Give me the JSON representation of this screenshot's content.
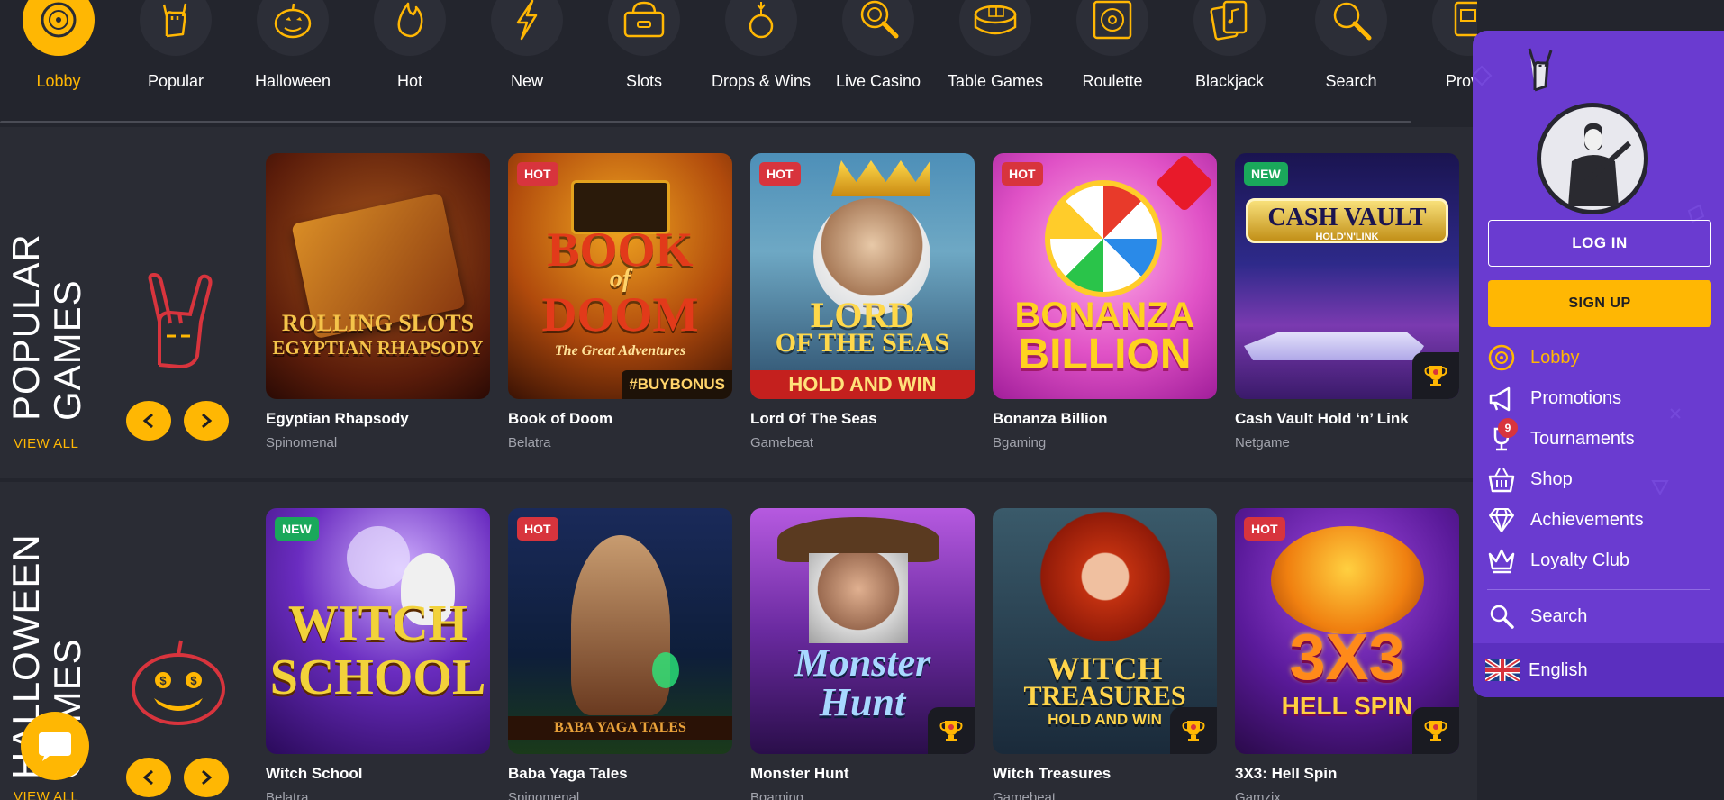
{
  "categories": [
    {
      "label": "Lobby",
      "icon": "disc-icon",
      "active": true
    },
    {
      "label": "Popular",
      "icon": "rock-hand-icon"
    },
    {
      "label": "Halloween",
      "icon": "pumpkin-icon"
    },
    {
      "label": "Hot",
      "icon": "flame-icon"
    },
    {
      "label": "New",
      "icon": "lightning-icon"
    },
    {
      "label": "Slots",
      "icon": "slot-machine-icon"
    },
    {
      "label": "Drops & Wins",
      "icon": "bomb-icon"
    },
    {
      "label": "Live Casino",
      "icon": "roulette-magnifier-icon"
    },
    {
      "label": "Table Games",
      "icon": "poker-table-icon"
    },
    {
      "label": "Roulette",
      "icon": "roulette-icon"
    },
    {
      "label": "Blackjack",
      "icon": "cards-icon"
    },
    {
      "label": "Search",
      "icon": "search-icon"
    },
    {
      "label": "Provic",
      "icon": "provider-icon"
    }
  ],
  "sections": [
    {
      "title_line1": "POPULAR",
      "title_line2": "GAMES",
      "view_all": "VIEW ALL",
      "games": [
        {
          "name": "Egyptian Rhapsody",
          "provider": "Spinomenal",
          "badge": "",
          "art": "ROLLING SLOTS\nEGYPTIAN RHAPSODY",
          "trophy": false
        },
        {
          "name": "Book of Doom",
          "provider": "Belatra",
          "badge": "HOT",
          "art": "BOOK\nof\nDOOM",
          "art_sub": "#BUYBONUS",
          "trophy": false
        },
        {
          "name": "Lord Of The Seas",
          "provider": "Gamebeat",
          "badge": "HOT",
          "art": "LORD\nOF THE SEAS",
          "art_sub": "HOLD AND WIN",
          "trophy": false
        },
        {
          "name": "Bonanza Billion",
          "provider": "Bgaming",
          "badge": "HOT",
          "art": "BONANZA\nBILLION",
          "trophy": false
        },
        {
          "name": "Cash Vault Hold ‘n’ Link",
          "provider": "Netgame",
          "badge": "NEW",
          "art": "CASH VAULT",
          "art_sub": "HOLD'N'LINK",
          "trophy": true
        }
      ]
    },
    {
      "title_line1": "HALLOWEEN",
      "title_line2": "GAMES",
      "view_all": "VIEW ALL",
      "games": [
        {
          "name": "Witch School",
          "provider": "Belatra",
          "badge": "NEW",
          "art": "WITCH\nSCHOOL",
          "trophy": false
        },
        {
          "name": "Baba Yaga Tales",
          "provider": "Spinomenal",
          "badge": "HOT",
          "art": "BABA YAGA TALES",
          "trophy": false
        },
        {
          "name": "Monster Hunt",
          "provider": "Bgaming",
          "badge": "",
          "art": "Monster\nHunt",
          "trophy": true
        },
        {
          "name": "Witch Treasures",
          "provider": "Gamebeat",
          "badge": "",
          "art": "WITCH\nTREASURES",
          "art_sub": "HOLD AND WIN",
          "trophy": true
        },
        {
          "name": "3X3: Hell Spin",
          "provider": "Gamzix",
          "badge": "HOT",
          "art": "3X3",
          "art_sub": "HELL SPIN",
          "trophy": true
        }
      ]
    }
  ],
  "panel": {
    "login": "LOG IN",
    "signup": "SIGN UP",
    "menu": [
      {
        "label": "Lobby",
        "icon": "disc-icon",
        "active": true
      },
      {
        "label": "Promotions",
        "icon": "megaphone-icon"
      },
      {
        "label": "Tournaments",
        "icon": "trophy-icon",
        "count": "9"
      },
      {
        "label": "Shop",
        "icon": "basket-icon"
      },
      {
        "label": "Achievements",
        "icon": "diamond-icon"
      },
      {
        "label": "Loyalty Club",
        "icon": "crown-icon"
      }
    ],
    "search": "Search",
    "language": "English"
  },
  "colors": {
    "accent": "#ffb703",
    "panel": "#6a3bd0",
    "bg": "#23252d",
    "hot": "#d8343d",
    "new": "#1aa85b"
  }
}
